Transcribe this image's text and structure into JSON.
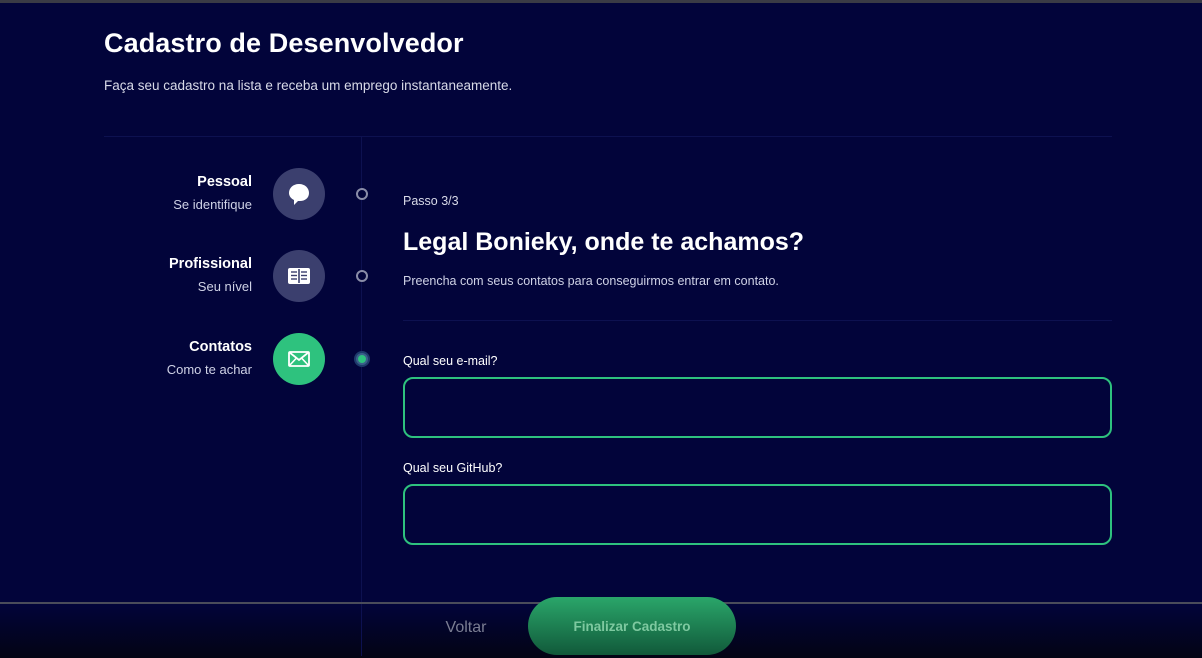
{
  "header": {
    "title": "Cadastro de Desenvolvedor",
    "subtitle": "Faça seu cadastro na lista e receba um emprego instantaneamente."
  },
  "steps": [
    {
      "title": "Pessoal",
      "subtitle": "Se identifique",
      "icon": "chat-bubble-icon",
      "active": false
    },
    {
      "title": "Profissional",
      "subtitle": "Seu nível",
      "icon": "book-icon",
      "active": false
    },
    {
      "title": "Contatos",
      "subtitle": "Como te achar",
      "icon": "mail-icon",
      "active": true
    }
  ],
  "form": {
    "step_indicator": "Passo 3/3",
    "title": "Legal Bonieky, onde te achamos?",
    "description": "Preencha com seus contatos para conseguirmos entrar em contato.",
    "email_label": "Qual seu e-mail?",
    "email_value": "",
    "github_label": "Qual seu GitHub?",
    "github_value": ""
  },
  "footer": {
    "back_label": "Voltar",
    "submit_label": "Finalizar Cadastro"
  },
  "colors": {
    "background": "#02043a",
    "accent": "#2ec27e",
    "inactive_icon_bg": "#3b3f6e"
  }
}
